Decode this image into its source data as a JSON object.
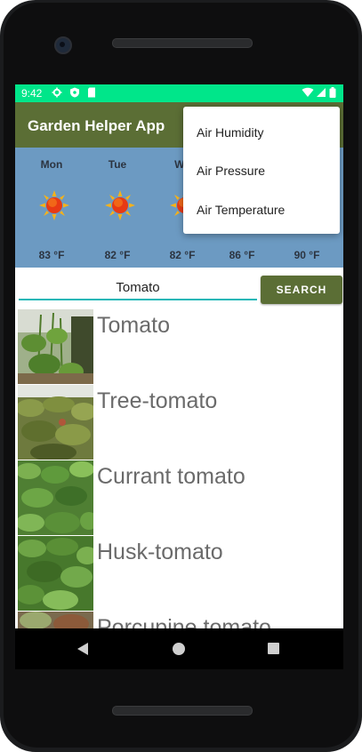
{
  "status_bar": {
    "time": "9:42"
  },
  "app_bar": {
    "title": "Garden Helper App"
  },
  "overflow_menu": {
    "items": [
      "Air Humidity",
      "Air Pressure",
      "Air Temperature"
    ]
  },
  "weather": {
    "days": [
      {
        "day": "Mon",
        "temp": "83 °F",
        "icon": "sun-icon"
      },
      {
        "day": "Tue",
        "temp": "82 °F",
        "icon": "sun-icon"
      },
      {
        "day": "We",
        "temp": "82 °F",
        "icon": "sun-icon"
      },
      {
        "day": "",
        "temp": "86 °F",
        "icon": "sun-icon"
      },
      {
        "day": "",
        "temp": "90 °F",
        "icon": "sun-icon"
      }
    ]
  },
  "search": {
    "value": "Tomato",
    "button_label": "SEARCH"
  },
  "results": [
    {
      "name": "Tomato"
    },
    {
      "name": "Tree-tomato"
    },
    {
      "name": "Currant tomato"
    },
    {
      "name": "Husk-tomato"
    },
    {
      "name": "Porcupine tomato"
    }
  ],
  "colors": {
    "status_bar": "#00e68a",
    "app_bar": "#5b6e35",
    "weather_bg": "#6c9ac2",
    "accent": "#18b7b7"
  }
}
